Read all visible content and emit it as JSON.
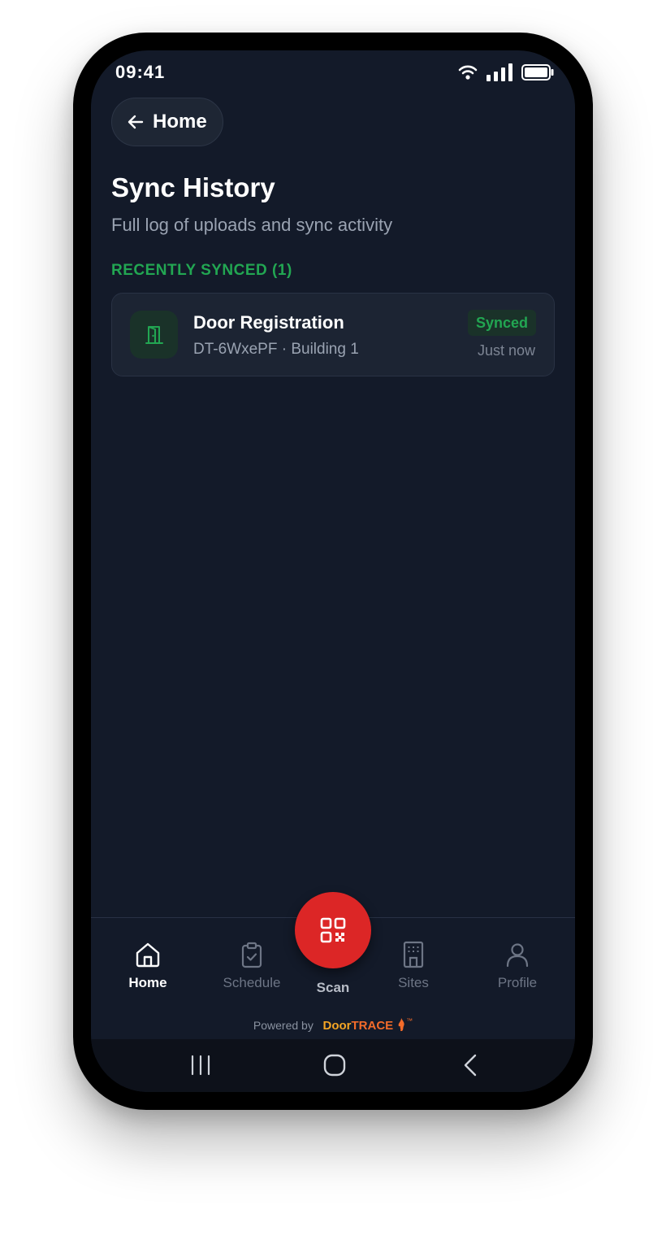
{
  "status_bar": {
    "time": "09:41"
  },
  "header": {
    "back_label": "Home"
  },
  "page": {
    "title": "Sync History",
    "subtitle": "Full log of uploads and sync activity",
    "section_label": "RECENTLY SYNCED (1)"
  },
  "sync_items": [
    {
      "title": "Door Registration",
      "subtitle": "DT-6WxePF · Building 1",
      "status": "Synced",
      "time": "Just now"
    }
  ],
  "bottom_nav": {
    "items": [
      {
        "label": "Home",
        "icon": "home-icon",
        "active": true
      },
      {
        "label": "Schedule",
        "icon": "clipboard-check-icon",
        "active": false
      },
      {
        "label": "Scan",
        "icon": "qr-code-icon",
        "active": false
      },
      {
        "label": "Sites",
        "icon": "building-icon",
        "active": false
      },
      {
        "label": "Profile",
        "icon": "user-icon",
        "active": false
      }
    ],
    "powered_by": "Powered by",
    "brand_part1": "Door",
    "brand_part2": "TRACE",
    "brand_tm": "™"
  },
  "colors": {
    "background": "#131a29",
    "accent_green": "#22a652",
    "scan_red": "#dc2626",
    "brand_orange": "#f26b2a"
  }
}
